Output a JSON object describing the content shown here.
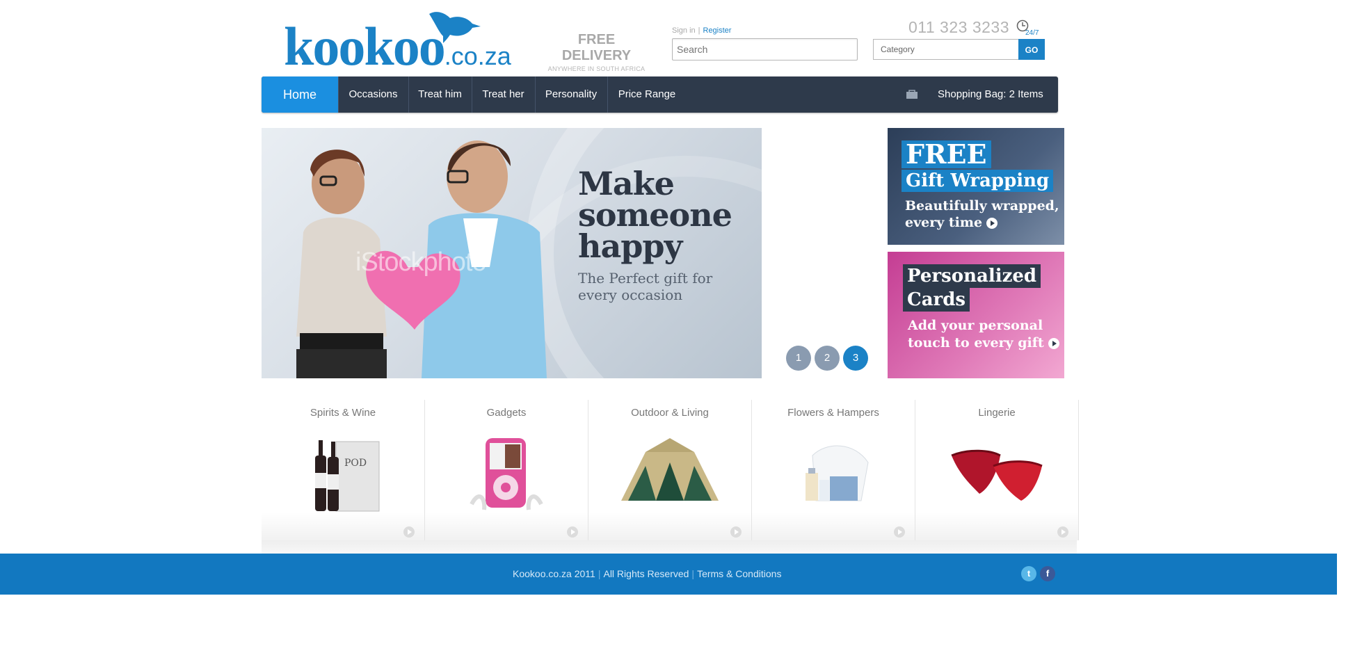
{
  "header": {
    "logo_main": "kookoo",
    "logo_tld": ".co.za",
    "delivery_title": "FREE DELIVERY",
    "delivery_sub": "ANYWHERE IN SOUTH AFRICA",
    "signin": "Sign in",
    "separator": "|",
    "register": "Register",
    "search_placeholder": "Search",
    "phone": "011 323 3233",
    "hours_badge": "24/7",
    "category_placeholder": "Category",
    "go_label": "GO"
  },
  "nav": {
    "items": [
      {
        "label": "Home",
        "active": true
      },
      {
        "label": "Occasions"
      },
      {
        "label": "Treat him"
      },
      {
        "label": "Treat her"
      },
      {
        "label": "Personality"
      },
      {
        "label": "Price Range"
      }
    ],
    "bag_label": "Shopping Bag: 2 Items"
  },
  "hero": {
    "title_line1": "Make",
    "title_line2": "someone",
    "title_line3": "happy",
    "sub_line1": "The Perfect gift for",
    "sub_line2": "every occasion",
    "watermark": "iStockphoto",
    "slides": [
      "1",
      "2",
      "3"
    ],
    "active_slide": 3
  },
  "promos": {
    "wrap": {
      "tag1": "FREE",
      "tag2": "Gift Wrapping",
      "line1": "Beautifully wrapped,",
      "line2": "every time"
    },
    "cards": {
      "tag1": "Personalized",
      "tag2": "Cards",
      "line1": "Add your personal",
      "line2": "touch to every gift"
    }
  },
  "categories": [
    {
      "label": "Spirits & Wine",
      "icon": "wine-bottles-icon"
    },
    {
      "label": "Gadgets",
      "icon": "mp3-player-icon"
    },
    {
      "label": "Outdoor & Living",
      "icon": "tent-icon"
    },
    {
      "label": "Flowers & Hampers",
      "icon": "hamper-icon"
    },
    {
      "label": "Lingerie",
      "icon": "lingerie-icon"
    }
  ],
  "footer": {
    "copyright": "Kookoo.co.za 2011",
    "rights": "All Rights Reserved",
    "terms": "Terms & Conditions",
    "separator": "|",
    "twitter": "t",
    "facebook": "f"
  },
  "colors": {
    "brand_blue": "#1b82c6",
    "nav_dark": "#2e3a4b",
    "promo_pink": "#d85aa8",
    "footer_blue": "#1278c0"
  }
}
